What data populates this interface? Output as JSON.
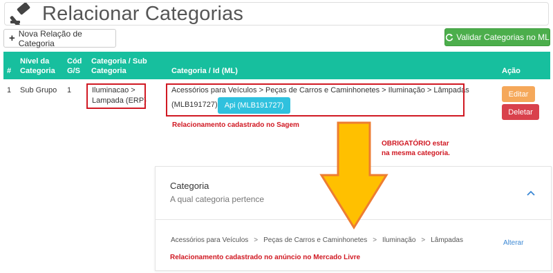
{
  "header": {
    "title": "Relacionar Categorias",
    "icon": "gavel-icon"
  },
  "buttons": {
    "new_label": "Nova Relação de Categoria",
    "validate_label": "Validar Categorias no ML"
  },
  "table": {
    "headers": {
      "num": "#",
      "nivel": [
        "Nível da",
        "Categoria"
      ],
      "cod": [
        "Cód",
        "G/S"
      ],
      "cat_sub": [
        "Categoria / Sub",
        "Categoria"
      ],
      "cat_id": "Categoria / Id (ML)",
      "acao": "Ação"
    },
    "rows": [
      {
        "num": "1",
        "nivel": "Sub Grupo",
        "cod": "1",
        "cat_sub": [
          "Iluminacao >",
          "Lampada (ERP)"
        ],
        "cat_id": [
          "Acessórios para Veículos > Peças de Carros e Caminhonetes > Iluminação > Lâmpadas",
          "(MLB191727)"
        ],
        "api_label": "Api (MLB191727)",
        "edit_label": "Editar",
        "delete_label": "Deletar"
      }
    ]
  },
  "annotations": {
    "sagem": "Relacionamento cadastrado no Sagem",
    "obrigatorio": [
      "OBRIGATÓRIO estar",
      "na mesma categoria."
    ],
    "mercado_livre": "Relacionamento cadastrado no anúncio no Mercado Livre"
  },
  "panel": {
    "title": "Categoria",
    "subtitle": "A qual categoria pertence",
    "breadcrumbs": [
      "Acessórios para Veículos",
      "Peças de Carros e Caminhonetes",
      "Iluminação",
      "Lâmpadas"
    ],
    "crumb_separator": ">",
    "alterar_label": "Alterar"
  },
  "colors": {
    "table_header": "#17bf9e",
    "validate_button": "#4cae4c",
    "api_button": "#2fc1de",
    "edit_button": "#f5a85a",
    "delete_button": "#d9414c",
    "annotation_red": "#d01822",
    "arrow_fill": "#ffc000",
    "arrow_stroke": "#ed7d31"
  }
}
